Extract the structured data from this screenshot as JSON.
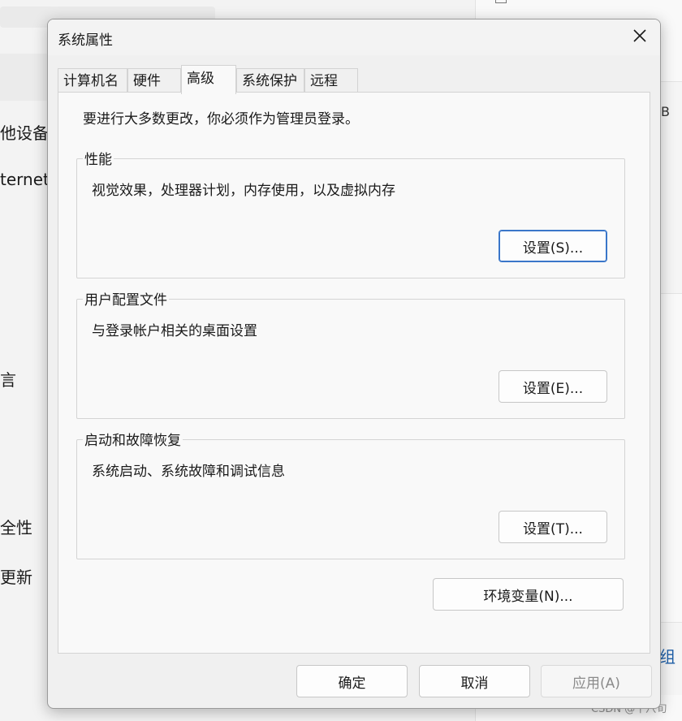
{
  "background": {
    "left_items": [
      "他设备",
      "ternet",
      "言",
      "全性",
      "更新"
    ],
    "right_side_text": "B",
    "right_blue_text": "组",
    "watermark": "CSDN @十八旬"
  },
  "dialog": {
    "title": "系统属性",
    "tabs": [
      {
        "label": "计算机名"
      },
      {
        "label": "硬件"
      },
      {
        "label": "高级"
      },
      {
        "label": "系统保护"
      },
      {
        "label": "远程"
      }
    ],
    "active_tab": "高级",
    "notice": "要进行大多数更改，你必须作为管理员登录。",
    "groups": [
      {
        "title": "性能",
        "description": "视觉效果，处理器计划，内存使用，以及虚拟内存",
        "button": "设置(S)..."
      },
      {
        "title": "用户配置文件",
        "description": "与登录帐户相关的桌面设置",
        "button": "设置(E)..."
      },
      {
        "title": "启动和故障恢复",
        "description": "系统启动、系统故障和调试信息",
        "button": "设置(T)..."
      }
    ],
    "env_button": "环境变量(N)...",
    "footer": {
      "ok": "确定",
      "cancel": "取消",
      "apply": "应用(A)"
    }
  },
  "colors": {
    "accent": "#3a76c9",
    "dialog_bg": "#f0f0f0",
    "content_bg": "#f9f9f9"
  }
}
